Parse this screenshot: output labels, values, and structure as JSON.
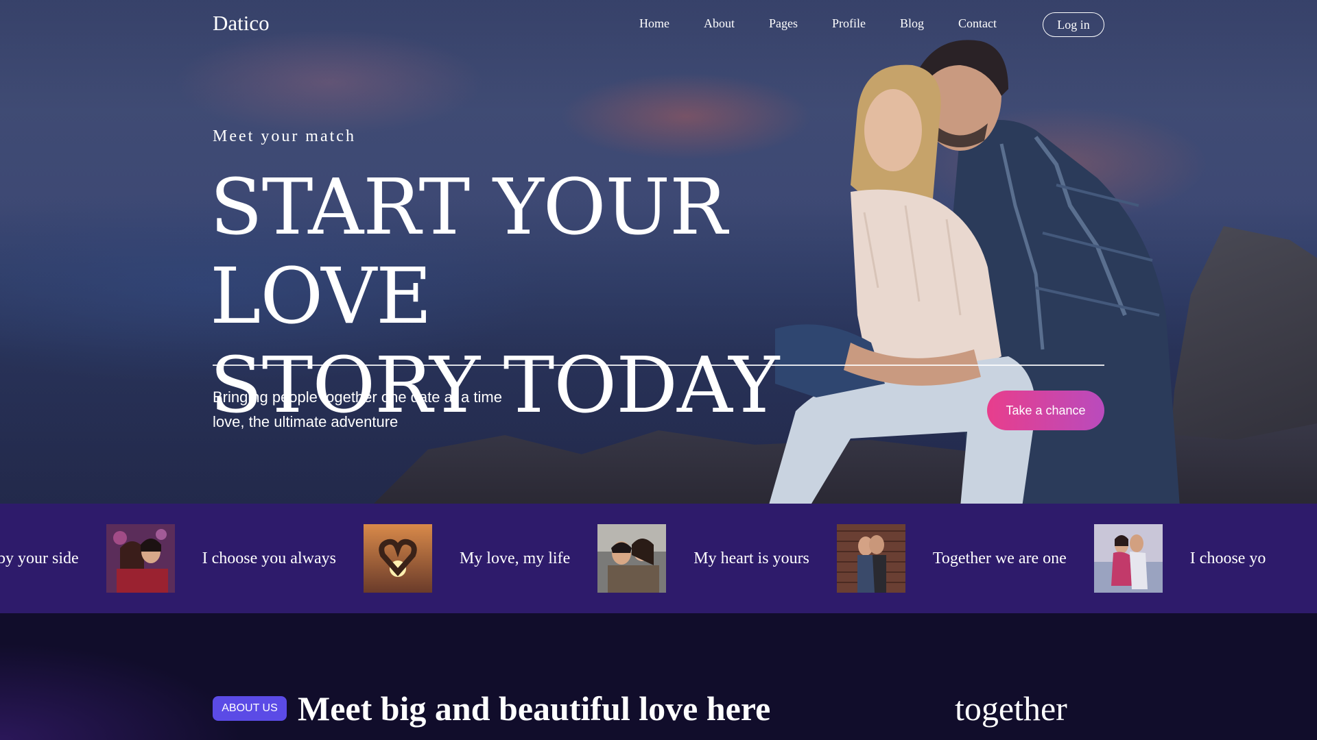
{
  "brand": {
    "logo": "Datico"
  },
  "nav": {
    "items": [
      "Home",
      "About",
      "Pages",
      "Profile",
      "Blog",
      "Contact"
    ],
    "login": "Log in"
  },
  "hero": {
    "eyebrow": "Meet your match",
    "headline_line1": "START YOUR LOVE",
    "headline_line2": "STORY TODAY",
    "subtext": "Bringing people together one date at a time love, the ultimate adventure",
    "cta": "Take a chance"
  },
  "ticker": {
    "items": [
      "ays by your side",
      "I choose you always",
      "My love, my life",
      "My heart is yours",
      "Together we are one",
      "I choose yo"
    ]
  },
  "about": {
    "badge": "ABOUT US",
    "title": "Meet big and beautiful love here",
    "title_right": "together"
  },
  "colors": {
    "ticker_bg": "#2e1b6b",
    "cta_gradient_start": "#e83e8c",
    "cta_gradient_end": "#b94bbd",
    "badge_bg": "#5b4be6",
    "page_bg": "#110d2b"
  }
}
